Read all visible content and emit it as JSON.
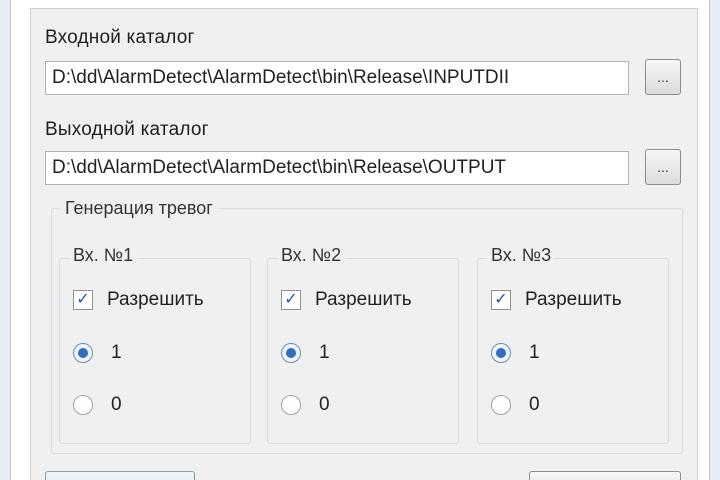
{
  "dialog": {
    "input_dir": {
      "label": "Входной каталог",
      "value": "D:\\dd\\AlarmDetect\\AlarmDetect\\bin\\Release\\INPUTDII",
      "browse_label": "..."
    },
    "output_dir": {
      "label": "Выходной каталог",
      "value": "D:\\dd\\AlarmDetect\\AlarmDetect\\bin\\Release\\OUTPUT",
      "browse_label": "..."
    },
    "alarm_group": {
      "title": "Генерация тревог",
      "inputs": [
        {
          "title": "Вх. №1",
          "allow_label": "Разрешить",
          "allow_checked": true,
          "option_one": "1",
          "option_zero": "0",
          "selected": "1"
        },
        {
          "title": "Вх. №2",
          "allow_label": "Разрешить",
          "allow_checked": true,
          "option_one": "1",
          "option_zero": "0",
          "selected": "1"
        },
        {
          "title": "Вх. №3",
          "allow_label": "Разрешить",
          "allow_checked": true,
          "option_one": "1",
          "option_zero": "0",
          "selected": "1"
        }
      ]
    }
  },
  "colors": {
    "accent": "#2f6fbf",
    "dialog_bg": "#f0f0f0",
    "border": "#d6dce3"
  },
  "icons": {
    "checkmark": "check-icon",
    "radio_selected": "radio-dot-icon"
  }
}
